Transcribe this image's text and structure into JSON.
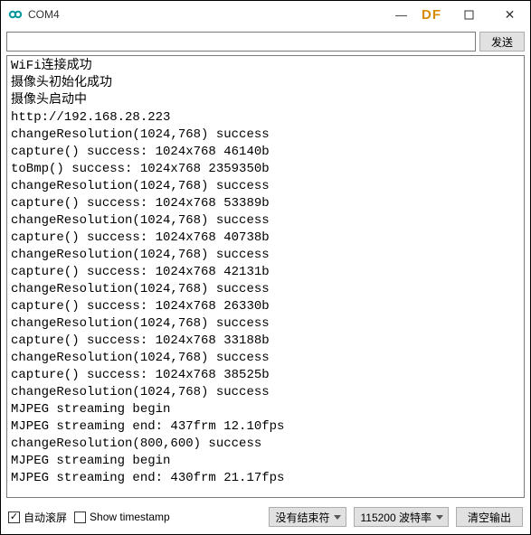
{
  "window": {
    "title": "COM4",
    "watermark": "DF"
  },
  "toolbar": {
    "send_button": "发送"
  },
  "input": {
    "value": "",
    "placeholder": ""
  },
  "console": {
    "lines": [
      "WiFi连接成功",
      "摄像头初始化成功",
      "摄像头启动中",
      "http://192.168.28.223",
      "changeResolution(1024,768) success",
      "capture() success: 1024x768 46140b",
      "toBmp() success: 1024x768 2359350b",
      "changeResolution(1024,768) success",
      "capture() success: 1024x768 53389b",
      "changeResolution(1024,768) success",
      "capture() success: 1024x768 40738b",
      "changeResolution(1024,768) success",
      "capture() success: 1024x768 42131b",
      "changeResolution(1024,768) success",
      "capture() success: 1024x768 26330b",
      "changeResolution(1024,768) success",
      "capture() success: 1024x768 33188b",
      "changeResolution(1024,768) success",
      "capture() success: 1024x768 38525b",
      "changeResolution(1024,768) success",
      "MJPEG streaming begin",
      "MJPEG streaming end: 437frm 12.10fps",
      "changeResolution(800,600) success",
      "MJPEG streaming begin",
      "MJPEG streaming end: 430frm 21.17fps"
    ]
  },
  "footer": {
    "autoscroll_label": "自动滚屏",
    "timestamp_label": "Show timestamp",
    "line_ending": "没有结束符",
    "baud": "115200 波特率",
    "clear_button": "清空输出"
  }
}
